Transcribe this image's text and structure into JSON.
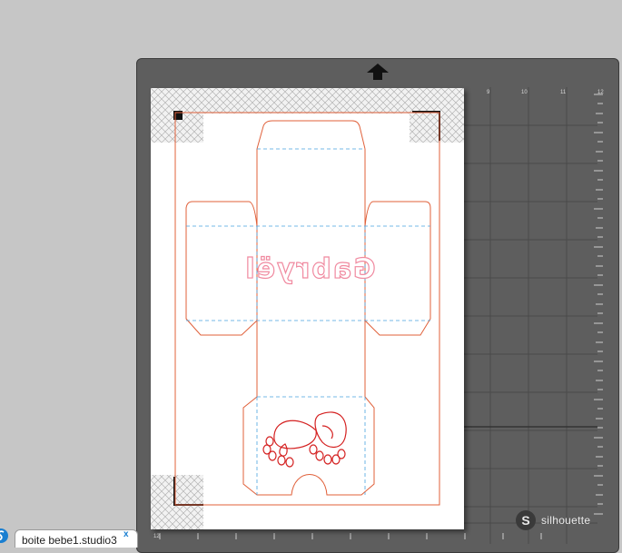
{
  "document_tab": {
    "label": "boite bebe1.studio3",
    "close_glyph": "x"
  },
  "ruler": {
    "top_numbers": [
      "9",
      "10",
      "11",
      "12"
    ],
    "corner_number": "12"
  },
  "branding": {
    "logo_letter": "S",
    "name": "silhouette"
  },
  "design": {
    "text": "Gabryël",
    "mirrored": true
  },
  "colors": {
    "background": "#c6c6c6",
    "mat": "#5e5e5e",
    "cut_line": "#e0603a",
    "fold_line": "#4aa3df",
    "text_outline": "#f08aa0",
    "feet_outline": "#d42020"
  }
}
